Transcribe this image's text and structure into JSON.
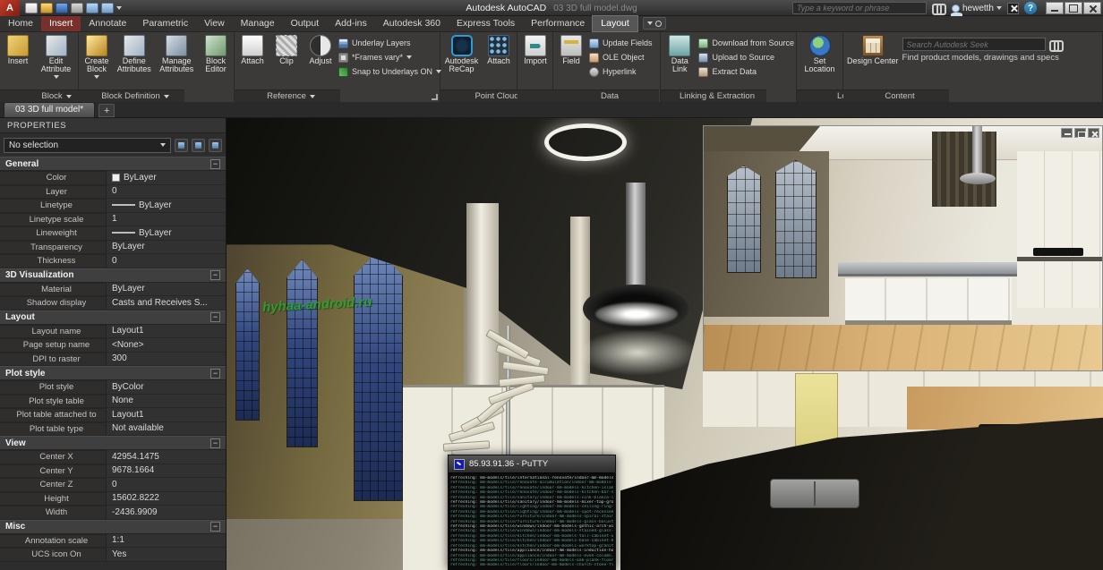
{
  "title_bar": {
    "app_icon_letter": "A",
    "app_title": "Autodesk AutoCAD",
    "doc_title": "03 3D full model.dwg",
    "search_placeholder": "Type a keyword or phrase",
    "username": "hewetth",
    "help_glyph": "?"
  },
  "ribbon": {
    "tabs": [
      {
        "label": "Home"
      },
      {
        "label": "Insert",
        "active": true
      },
      {
        "label": "Annotate"
      },
      {
        "label": "Parametric"
      },
      {
        "label": "View"
      },
      {
        "label": "Manage"
      },
      {
        "label": "Output"
      },
      {
        "label": "Add-ins"
      },
      {
        "label": "Autodesk 360"
      },
      {
        "label": "Express Tools"
      },
      {
        "label": "Performance"
      },
      {
        "label": "Layout",
        "highlight": true
      }
    ],
    "panels": {
      "block": {
        "label": "Block",
        "insert": "Insert",
        "edit_attribute": "Edit Attribute"
      },
      "block_definition": {
        "label": "Block Definition",
        "create_block": "Create Block",
        "define_attributes": "Define Attributes",
        "manage_attributes": "Manage Attributes",
        "block_editor": "Block Editor"
      },
      "reference": {
        "label": "Reference",
        "attach": "Attach",
        "clip": "Clip",
        "adjust": "Adjust",
        "underlay_layers": "Underlay Layers",
        "frames": "*Frames vary*",
        "snap": "Snap to Underlays ON"
      },
      "point_cloud": {
        "label": "Point Cloud",
        "recap": "Autodesk ReCap",
        "attach": "Attach"
      },
      "import": {
        "label": "Import",
        "import": "Import"
      },
      "data": {
        "label": "Data",
        "field": "Field",
        "update_fields": "Update Fields",
        "ole_object": "OLE Object",
        "hyperlink": "Hyperlink"
      },
      "linking": {
        "label": "Linking & Extraction",
        "data_link": "Data Link",
        "download": "Download from Source",
        "upload": "Upload to Source",
        "extract": "Extract Data"
      },
      "location": {
        "label": "Location",
        "set_location": "Set Location"
      },
      "content": {
        "label": "Content",
        "design_center": "Design Center",
        "seek_placeholder": "Search Autodesk Seek",
        "seek_hint": "Find product models, drawings and specs"
      }
    }
  },
  "document_tabs": {
    "active_tab": "03 3D full model*",
    "new_tab_glyph": "+"
  },
  "properties": {
    "title": "PROPERTIES",
    "selection": "No selection",
    "collapse_glyph": "−",
    "sections": [
      {
        "title": "General",
        "rows": [
          {
            "label": "Color",
            "value": "ByLayer",
            "swatch": "color"
          },
          {
            "label": "Layer",
            "value": "0"
          },
          {
            "label": "Linetype",
            "value": "ByLayer",
            "swatch": "line"
          },
          {
            "label": "Linetype scale",
            "value": "1"
          },
          {
            "label": "Lineweight",
            "value": "ByLayer",
            "swatch": "line"
          },
          {
            "label": "Transparency",
            "value": "ByLayer"
          },
          {
            "label": "Thickness",
            "value": "0"
          }
        ]
      },
      {
        "title": "3D Visualization",
        "rows": [
          {
            "label": "Material",
            "value": "ByLayer"
          },
          {
            "label": "Shadow display",
            "value": "Casts and Receives S..."
          }
        ]
      },
      {
        "title": "Layout",
        "rows": [
          {
            "label": "Layout name",
            "value": "Layout1"
          },
          {
            "label": "Page setup name",
            "value": "<None>"
          },
          {
            "label": "DPI to raster",
            "value": "300"
          }
        ]
      },
      {
        "title": "Plot style",
        "rows": [
          {
            "label": "Plot style",
            "value": "ByColor"
          },
          {
            "label": "Plot style table",
            "value": "None"
          },
          {
            "label": "Plot table attached to",
            "value": "Layout1"
          },
          {
            "label": "Plot table type",
            "value": "Not available"
          }
        ]
      },
      {
        "title": "View",
        "rows": [
          {
            "label": "Center X",
            "value": "42954.1475"
          },
          {
            "label": "Center Y",
            "value": "9678.1664"
          },
          {
            "label": "Center Z",
            "value": "0"
          },
          {
            "label": "Height",
            "value": "15602.8222"
          },
          {
            "label": "Width",
            "value": "-2436.9909"
          }
        ]
      },
      {
        "title": "Misc",
        "rows": [
          {
            "label": "Annotation scale",
            "value": "1:1"
          },
          {
            "label": "UCS icon On",
            "value": "Yes"
          }
        ]
      }
    ]
  },
  "viewport": {
    "watermark": "hyhaa-android.ru"
  },
  "putty": {
    "title": "85.93.91.36 - PuTTY",
    "lines": [
      "refreshing: mm-models/tile/international-renovate/indoor-mm-models-exhauster-model_dxf.png",
      "refreshing: mm-models/tile/renovate-accumulation/indoor-mm-models-cooker-hood-white.png",
      "refreshing: mm-models/tile/renovate/indoor-mm-models-kitchen-island-top_3ds.png",
      "refreshing: mm-models/tile/renovate/indoor-mm-models-kitchen-bar-stool.png",
      "refreshing: mm-models/tile/sanitary/indoor-mm-models-sink-blanco-left.png",
      "refreshing: mm-models/tile/sanitary/indoor-mm-models-mixer-tap-grohe.png",
      "refreshing: mm-models/tile/lighting/indoor-mm-models-ceiling-ring-light.png",
      "refreshing: mm-models/tile/lighting/indoor-mm-models-spot-recessed.png",
      "refreshing: mm-models/tile/furniture/indoor-mm-models-spiral-staircase.png",
      "refreshing: mm-models/tile/furniture/indoor-mm-models-glass-balustrade.png",
      "refreshing: mm-models/tile/windows/indoor-mm-models-gothic-arch-window.png",
      "refreshing: mm-models/tile/windows/indoor-mm-models-stained-glass-panel.png",
      "refreshing: mm-models/tile/kitchen/indoor-mm-models-tall-cabinet-unit.png",
      "refreshing: mm-models/tile/kitchen/indoor-mm-models-base-cabinet-800.png",
      "refreshing: mm-models/tile/kitchen/indoor-mm-models-worktop-granite.png",
      "refreshing: mm-models/tile/appliance/indoor-mm-models-induction-hob-900.png",
      "refreshing: mm-models/tile/appliance/indoor-mm-models-oven-column.png",
      "refreshing: mm-models/tile/floors/indoor-mm-models-oak-plank-floor.png",
      "refreshing: mm-models/tile/floors/indoor-mm-models-church-stone-floor.png"
    ]
  }
}
